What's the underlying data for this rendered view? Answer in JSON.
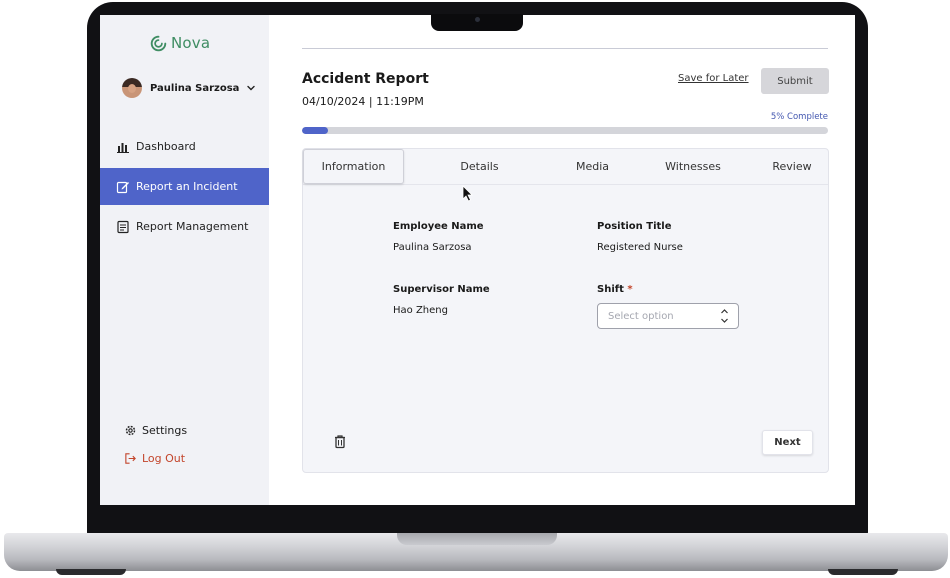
{
  "sidebar": {
    "brand": "Nova",
    "user_name": "Paulina Sarzosa",
    "nav": [
      {
        "label": "Dashboard",
        "icon": "bar-chart-icon"
      },
      {
        "label": "Report an Incident",
        "icon": "edit-icon",
        "active": true
      },
      {
        "label": "Report Management",
        "icon": "document-icon"
      }
    ],
    "settings_label": "Settings",
    "logout_label": "Log Out"
  },
  "header": {
    "title": "Accident Report",
    "datetime": "04/10/2024 | 11:19PM",
    "save_later_label": "Save for Later",
    "submit_label": "Submit"
  },
  "progress": {
    "label": "5% Complete",
    "value": 5
  },
  "tabs": [
    "Information",
    "Details",
    "Media",
    "Witnesses",
    "Review"
  ],
  "form": {
    "employee_name_label": "Employee Name",
    "employee_name_value": "Paulina Sarzosa",
    "position_title_label": "Position Title",
    "position_title_value": "Registered Nurse",
    "supervisor_name_label": "Supervisor Name",
    "supervisor_name_value": "Hao Zheng",
    "shift_label": "Shift",
    "shift_required_mark": "*",
    "shift_placeholder": "Select option"
  },
  "footer": {
    "next_label": "Next"
  },
  "colors": {
    "accent": "#4f64c9",
    "brand_green": "#3f8d63",
    "danger": "#c3452b"
  }
}
